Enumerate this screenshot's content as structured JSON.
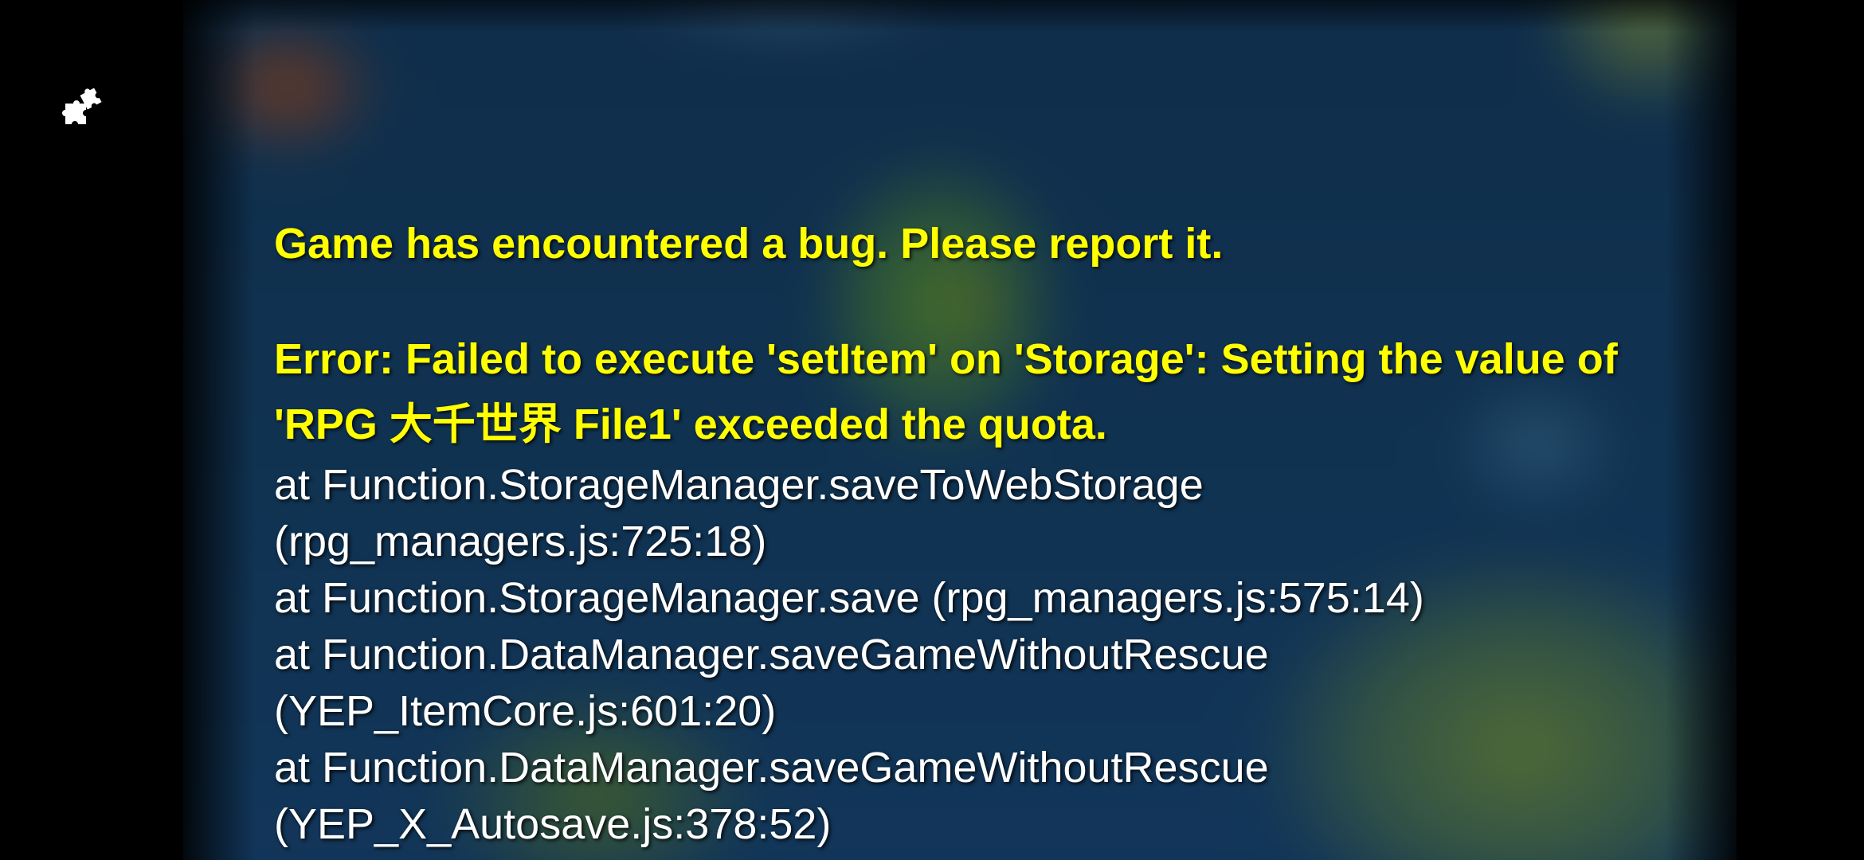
{
  "icons": {
    "mod_button": "puzzle-piece-icon"
  },
  "colors": {
    "error_title": "#ffff00",
    "stack_text": "#ffffff",
    "letterbox": "#000000"
  },
  "error": {
    "title": "Game has encountered a bug. Please report it.",
    "message": "Error: Failed to execute 'setItem' on 'Storage': Setting the value of 'RPG 大千世界 File1' exceeded the quota.",
    "stack": [
      "at Function.StorageManager.saveToWebStorage",
      "(rpg_managers.js:725:18)",
      "at Function.StorageManager.save (rpg_managers.js:575:14)",
      "at Function.DataManager.saveGameWithoutRescue",
      "(YEP_ItemCore.js:601:20)",
      "at Function.DataManager.saveGameWithoutRescue",
      "(YEP_X_Autosave.js:378:52)"
    ]
  }
}
